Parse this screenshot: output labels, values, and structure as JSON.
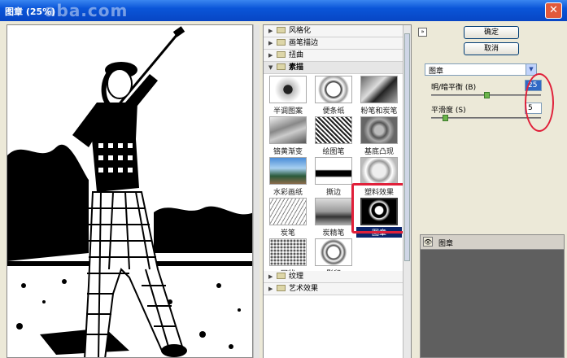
{
  "window": {
    "title": "图章 (25%)",
    "watermark": "aba.com",
    "close_label": "✕"
  },
  "categories_top": [
    {
      "label": "风格化",
      "open": false
    },
    {
      "label": "画笔描边",
      "open": false
    },
    {
      "label": "扭曲",
      "open": false
    },
    {
      "label": "素描",
      "open": true
    }
  ],
  "thumbnails": [
    {
      "label": "半调图案"
    },
    {
      "label": "便条纸"
    },
    {
      "label": "粉笔和炭笔"
    },
    {
      "label": "铬黄渐变"
    },
    {
      "label": "绘图笔"
    },
    {
      "label": "基底凸现"
    },
    {
      "label": "水彩画纸"
    },
    {
      "label": "撕边"
    },
    {
      "label": "塑料效果"
    },
    {
      "label": "炭笔"
    },
    {
      "label": "炭精笔"
    },
    {
      "label": "图章",
      "selected": true
    },
    {
      "label": "网状"
    },
    {
      "label": "影印"
    }
  ],
  "categories_bottom": [
    {
      "label": "纹理"
    },
    {
      "label": "艺术效果"
    }
  ],
  "buttons": {
    "ok": "确定",
    "cancel": "取消",
    "collapse": "»"
  },
  "filter_select": {
    "value": "图章",
    "arrow": "▼"
  },
  "params": {
    "light_dark": {
      "label": "明/暗平衡 (B)",
      "value": "25",
      "fraction": 0.48
    },
    "smoothness": {
      "label": "平滑度 (S)",
      "value": "5",
      "fraction": 0.1
    }
  },
  "layers": [
    {
      "name": "图章",
      "eye": "👁"
    }
  ],
  "colors": {
    "highlight_red": "#e0203a",
    "title_blue": "#0a55d8"
  }
}
